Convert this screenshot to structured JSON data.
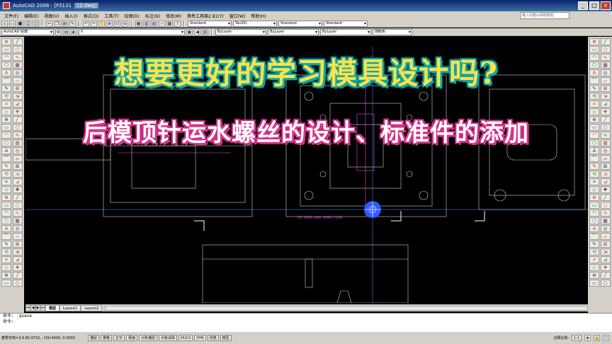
{
  "window": {
    "title": "AutoCAD 2008 - [F5131",
    "doc_tag": "12.dwg]",
    "buttons": [
      "_",
      "□",
      "×"
    ]
  },
  "menu": {
    "items": [
      "文件(F)",
      "编辑(E)",
      "视图(V)",
      "插入(I)",
      "格式(O)",
      "工具(T)",
      "绘图(D)",
      "标注(N)",
      "修改(M)",
      "燕秀工具箱2.81(Y)",
      "窗口(W)",
      "帮助(H)"
    ],
    "help_placeholder": "键入问题以获取帮助"
  },
  "toolbar1": {
    "style_combo_1": "Standard",
    "style_combo_2": "TanZiti",
    "style_combo_3": "Standard",
    "style_combo_4": "Standard"
  },
  "toolbar2": {
    "workspace": "AutoCAD 经典",
    "layer": "0",
    "color": "ByLayer",
    "linetype": "ByLayer",
    "lineweight": "ByLayer",
    "plotstyle": "随颜色"
  },
  "overlay": {
    "line1": "想要更好的学习模具设计吗?",
    "line2": "后模顶针运水螺丝的设计、标准件的添加"
  },
  "drawing": {
    "part_label": "CE-0000-A00-0000-C100"
  },
  "tabs": {
    "model": "模型",
    "layout1": "Layout1",
    "layout2": "Layout2"
  },
  "command": {
    "line1": "命令: _qsave",
    "line2": "命令:"
  },
  "status": {
    "coords": "乘秀字高=3.9  80.9732, -150.4490, 0.0000",
    "buttons": [
      "捕捉",
      "栅格",
      "正交",
      "极轴",
      "对象捕捉",
      "对象追踪",
      "DUCS",
      "DYN",
      "线宽",
      "模型"
    ],
    "annotation_scale_label": "注释比例:",
    "annotation_scale": "1:1"
  },
  "colors": {
    "overlay1_fill": "#ffe14a",
    "overlay1_stroke": "#0aa6a6",
    "overlay2_fill": "#ffffff",
    "overlay2_stroke": "#d6338a",
    "canvas_bg": "#000000",
    "cursor_blue": "#2d5bff"
  }
}
